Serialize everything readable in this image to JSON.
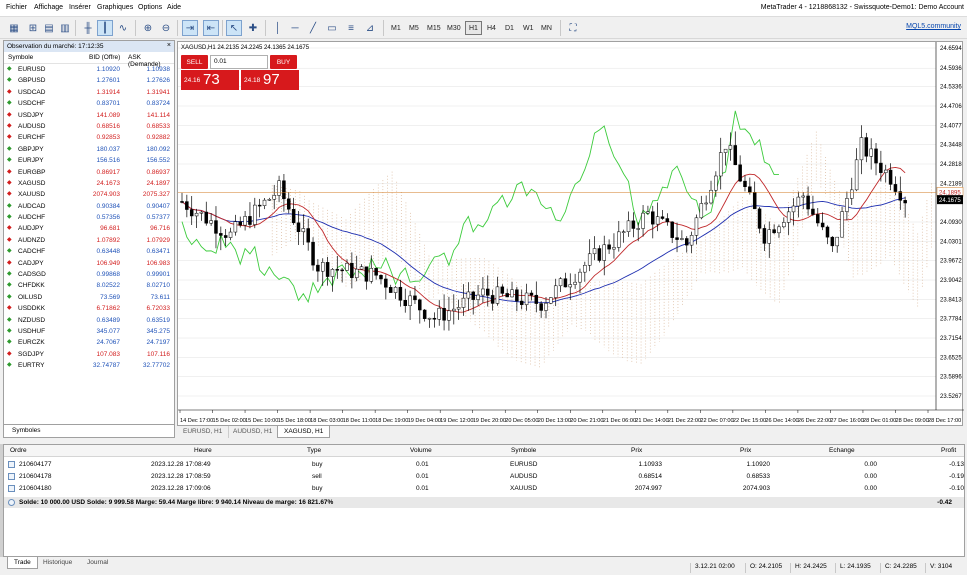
{
  "menu": [
    "Fichier",
    "Affichage",
    "Insérer",
    "Graphiques",
    "Options",
    "Aide"
  ],
  "window_title": "MetaTrader 4 - 1218868132 - Swissquote-Demo1: Demo Account",
  "toolbar": {
    "timeframes": [
      "M1",
      "M5",
      "M15",
      "M30",
      "H1",
      "H4",
      "D1",
      "W1",
      "MN"
    ],
    "selected_tf": "H1",
    "mql5_label": "MQL5.community"
  },
  "market_watch": {
    "title": "Observation du marché: 17:12:35",
    "columns": [
      "Symbole",
      "BID (Offre)",
      "ASK (Demande)"
    ],
    "rows": [
      {
        "sym": "EURUSD",
        "bid": "1.10920",
        "ask": "1.10938",
        "dir": "up"
      },
      {
        "sym": "GBPUSD",
        "bid": "1.27601",
        "ask": "1.27626",
        "dir": "up"
      },
      {
        "sym": "USDCAD",
        "bid": "1.31914",
        "ask": "1.31941",
        "dir": "dn"
      },
      {
        "sym": "USDCHF",
        "bid": "0.83701",
        "ask": "0.83724",
        "dir": "up"
      },
      {
        "sym": "USDJPY",
        "bid": "141.089",
        "ask": "141.114",
        "dir": "dn"
      },
      {
        "sym": "AUDUSD",
        "bid": "0.68516",
        "ask": "0.68533",
        "dir": "dn"
      },
      {
        "sym": "EURCHF",
        "bid": "0.92853",
        "ask": "0.92882",
        "dir": "dn"
      },
      {
        "sym": "GBPJPY",
        "bid": "180.037",
        "ask": "180.092",
        "dir": "up"
      },
      {
        "sym": "EURJPY",
        "bid": "156.516",
        "ask": "156.552",
        "dir": "up"
      },
      {
        "sym": "EURGBP",
        "bid": "0.86917",
        "ask": "0.86937",
        "dir": "dn"
      },
      {
        "sym": "XAGUSD",
        "bid": "24.1673",
        "ask": "24.1897",
        "dir": "dn"
      },
      {
        "sym": "XAUUSD",
        "bid": "2074.903",
        "ask": "2075.327",
        "dir": "dn"
      },
      {
        "sym": "AUDCAD",
        "bid": "0.90384",
        "ask": "0.90407",
        "dir": "up"
      },
      {
        "sym": "AUDCHF",
        "bid": "0.57356",
        "ask": "0.57377",
        "dir": "up"
      },
      {
        "sym": "AUDJPY",
        "bid": "96.681",
        "ask": "96.716",
        "dir": "dn"
      },
      {
        "sym": "AUDNZD",
        "bid": "1.07892",
        "ask": "1.07929",
        "dir": "dn"
      },
      {
        "sym": "CADCHF",
        "bid": "0.63448",
        "ask": "0.63471",
        "dir": "up"
      },
      {
        "sym": "CADJPY",
        "bid": "106.949",
        "ask": "106.983",
        "dir": "dn"
      },
      {
        "sym": "CADSGD",
        "bid": "0.99868",
        "ask": "0.99901",
        "dir": "up"
      },
      {
        "sym": "CHFDKK",
        "bid": "8.02522",
        "ask": "8.02710",
        "dir": "up"
      },
      {
        "sym": "OILUSD",
        "bid": "73.569",
        "ask": "73.611",
        "dir": "up"
      },
      {
        "sym": "USDDKK",
        "bid": "6.71862",
        "ask": "6.72033",
        "dir": "dn"
      },
      {
        "sym": "NZDUSD",
        "bid": "0.63489",
        "ask": "0.63519",
        "dir": "up"
      },
      {
        "sym": "USDHUF",
        "bid": "345.077",
        "ask": "345.275",
        "dir": "up"
      },
      {
        "sym": "EURCZK",
        "bid": "24.7067",
        "ask": "24.7197",
        "dir": "up"
      },
      {
        "sym": "SGDJPY",
        "bid": "107.083",
        "ask": "107.116",
        "dir": "dn"
      },
      {
        "sym": "EURTRY",
        "bid": "32.74787",
        "ask": "32.77702",
        "dir": "up"
      }
    ],
    "tab": "Symboles"
  },
  "chart": {
    "symbol_line": "XAGUSD,H1  24.2135 24.2245 24.1365 24.1675",
    "one_click": {
      "sell": "SELL",
      "buy": "BUY",
      "lot": "0.01",
      "sell_small": "24.16",
      "sell_big": "73",
      "buy_small": "24.18",
      "buy_big": "97"
    },
    "price_labels": [
      "24.6594",
      "24.5936",
      "24.5336",
      "24.4706",
      "24.4077",
      "24.3448",
      "24.2818",
      "24.2189",
      "24.1895",
      "24.1675",
      "24.0930",
      "24.0301",
      "23.9672",
      "23.9042",
      "23.8413",
      "23.7784",
      "23.7154",
      "23.6525",
      "23.5896",
      "23.5267"
    ],
    "bid_label": "24.1675",
    "ask_label": "24.1895",
    "time_labels": [
      "14 Dec 17:00",
      "15 Dec 02:00",
      "15 Dec 10:00",
      "15 Dec 18:00",
      "18 Dec 03:00",
      "18 Dec 11:00",
      "18 Dec 19:00",
      "19 Dec 04:00",
      "19 Dec 12:00",
      "19 Dec 20:00",
      "20 Dec 05:00",
      "20 Dec 13:00",
      "20 Dec 21:00",
      "21 Dec 06:00",
      "21 Dec 14:00",
      "21 Dec 22:00",
      "22 Dec 07:00",
      "22 Dec 15:00",
      "26 Dec 14:00",
      "26 Dec 22:00",
      "27 Dec 16:00",
      "28 Dec 01:00",
      "28 Dec 09:00",
      "28 Dec 17:00"
    ],
    "tabs": [
      "EURUSD, H1",
      "AUDUSD, H1",
      "XAGUSD, H1"
    ],
    "selected_tab": "XAGUSD, H1",
    "colors": {
      "ichimoku_cloud": "#d9b89c",
      "tenkan": "#c0292b",
      "kijun": "#1f2fb0",
      "chikou": "#3ccb3c",
      "candle": "#000000",
      "grid": "#e2e2e2",
      "ask_line": "#d07a22"
    }
  },
  "trade": {
    "columns": [
      "Ordre",
      "Heure",
      "Type",
      "Volume",
      "Symbole",
      "Prix",
      "Prix",
      "Echange",
      "Profit"
    ],
    "rows": [
      {
        "order": "210604177",
        "time": "2023.12.28 17:08:49",
        "type": "buy",
        "volume": "0.01",
        "symbol": "EURUSD",
        "price": "1.10933",
        "current": "1.10920",
        "swap": "0.00",
        "profit": "-0.13"
      },
      {
        "order": "210604178",
        "time": "2023.12.28 17:08:59",
        "type": "sell",
        "volume": "0.01",
        "symbol": "AUDUSD",
        "price": "0.68514",
        "current": "0.68533",
        "swap": "0.00",
        "profit": "-0.19"
      },
      {
        "order": "210604180",
        "time": "2023.12.28 17:09:06",
        "type": "buy",
        "volume": "0.01",
        "symbol": "XAUUSD",
        "price": "2074.997",
        "current": "2074.903",
        "swap": "0.00",
        "profit": "-0.10"
      }
    ],
    "balance_text": "Solde: 10 000.00 USD  Solde: 9 999.58  Marge: 59.44  Marge libre: 9 940.14  Niveau de marge: 16 821.67%",
    "balance_profit": "-0.42",
    "tabs": [
      "Trade",
      "Historique",
      "Journal"
    ],
    "selected_tab": "Trade"
  },
  "status": {
    "time": "3.12.21 02:00",
    "open": "O: 24.2105",
    "high": "H: 24.2425",
    "low": "L: 24.1935",
    "close": "C: 24.2285",
    "volume": "V: 3104"
  }
}
